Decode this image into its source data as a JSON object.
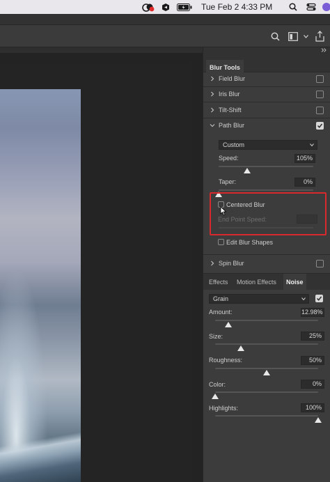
{
  "menubar": {
    "clock": "Tue Feb 2  4:33 PM"
  },
  "panel": {
    "title": "Blur Tools",
    "blur_tools": [
      {
        "label": "Field Blur",
        "checked": false
      },
      {
        "label": "Iris Blur",
        "checked": false
      },
      {
        "label": "Tilt-Shift",
        "checked": false
      },
      {
        "label": "Path Blur",
        "checked": true
      }
    ],
    "path_blur": {
      "mode": "Custom",
      "speed_label": "Speed:",
      "speed_value": "105%",
      "speed_level": 0.3,
      "taper_label": "Taper:",
      "taper_value": "0%",
      "taper_level": 0.0,
      "centered_blur_label": "Centered Blur",
      "centered_blur_checked": false,
      "end_point_speed_label": "End Point Speed:",
      "end_point_speed_value": "",
      "edit_blur_shapes_label": "Edit Blur Shapes",
      "edit_blur_shapes_checked": false
    },
    "spin_blur": {
      "label": "Spin Blur",
      "checked": false
    },
    "tabs": [
      {
        "label": "Effects",
        "active": false
      },
      {
        "label": "Motion Effects",
        "active": false
      },
      {
        "label": "Noise",
        "active": true
      }
    ],
    "noise": {
      "type": "Grain",
      "enabled": true,
      "amount_label": "Amount:",
      "amount_value": "12.98%",
      "amount_level": 0.1298,
      "size_label": "Size:",
      "size_value": "25%",
      "size_level": 0.25,
      "roughness_label": "Roughness:",
      "roughness_value": "50%",
      "roughness_level": 0.5,
      "color_label": "Color:",
      "color_value": "0%",
      "color_level": 0.0,
      "highlights_label": "Highlights:",
      "highlights_value": "100%",
      "highlights_level": 1.0
    }
  },
  "colors": {
    "highlight_box": "#d8292d",
    "panel_bg": "#3c3c3c",
    "canvas_bg": "#232323"
  }
}
